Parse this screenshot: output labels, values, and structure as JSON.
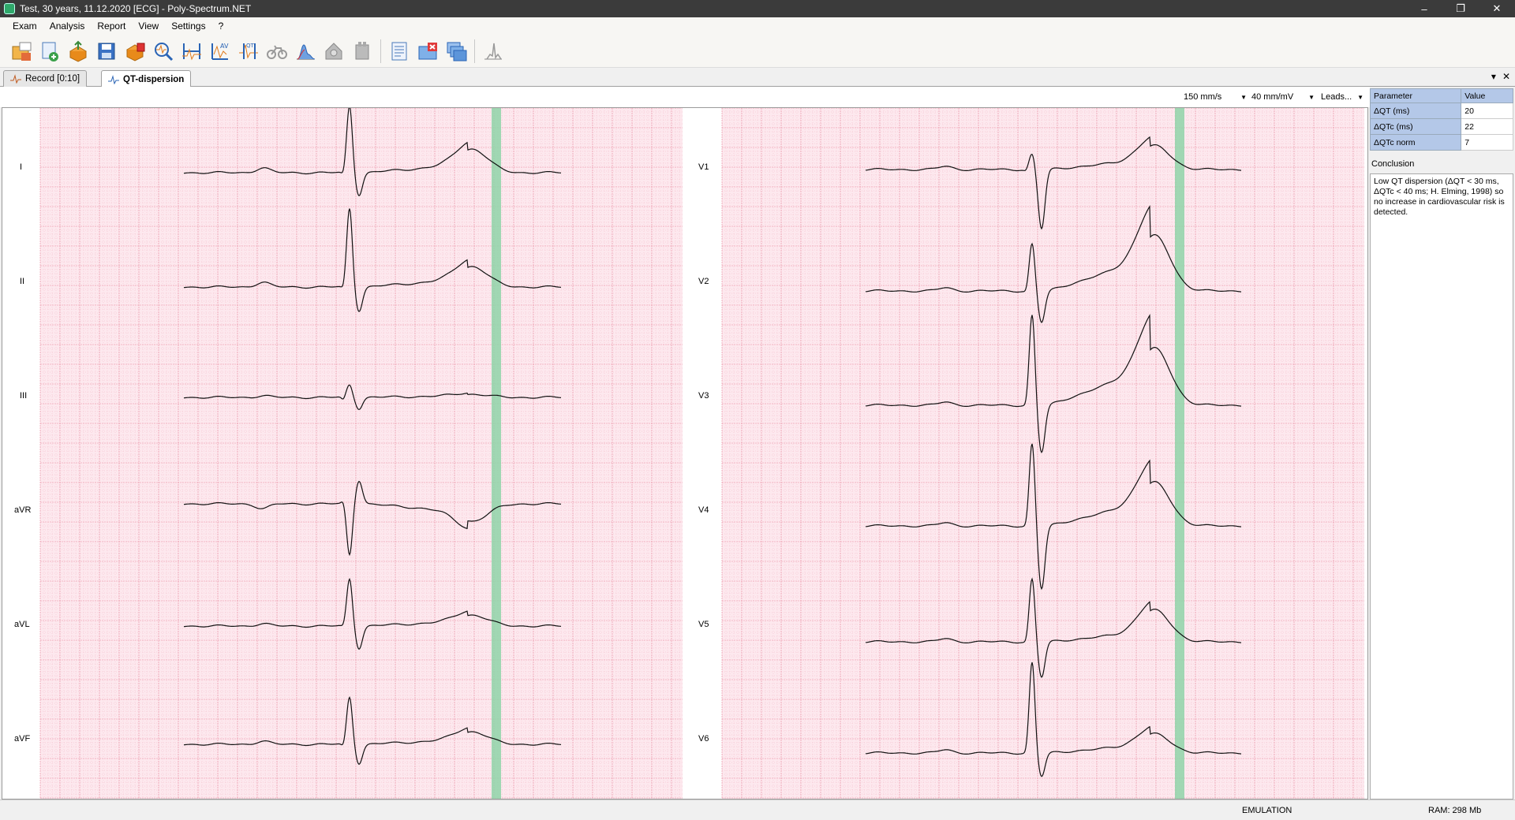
{
  "window": {
    "title": "Test, 30 years, 11.12.2020 [ECG] - Poly-Spectrum.NET",
    "minimize": "–",
    "restore": "❐",
    "close": "✕"
  },
  "menu": [
    "Exam",
    "Analysis",
    "Report",
    "View",
    "Settings",
    "?"
  ],
  "toolbar": {
    "icons": [
      "open-exam-icon",
      "import-icon",
      "export-icon",
      "save-icon",
      "print-icon",
      "ecg-zoom-icon",
      "interval-measure-icon",
      "amplitude-measure-icon",
      "qt-measure-icon",
      "bicycle-test-icon",
      "spectrum-icon",
      "home-icon",
      "device-icon",
      "report-icon",
      "close-window-icon",
      "windows-icon",
      "signal-icon"
    ],
    "separator_after": [
      12,
      15
    ]
  },
  "tabs": [
    {
      "label": "Record [0:10]",
      "active": false
    },
    {
      "label": "QT-dispersion",
      "active": true
    }
  ],
  "tab_controls": {
    "dropdown": "▾",
    "close": "✕"
  },
  "options": {
    "speed": "150 mm/s",
    "gain": "40 mm/mV",
    "leads": "Leads..."
  },
  "leads_left": [
    "I",
    "II",
    "III",
    "aVR",
    "aVL",
    "aVF"
  ],
  "leads_right": [
    "V1",
    "V2",
    "V3",
    "V4",
    "V5",
    "V6"
  ],
  "colors": {
    "grid_minor": "#f3b8c4",
    "grid_major": "#e8879c",
    "paper": "#fde8ee",
    "qt_marker": "#8fd3a8",
    "trace": "#111111"
  },
  "parameters": {
    "header": {
      "name": "Parameter",
      "value": "Value"
    },
    "rows": [
      {
        "name": "ΔQT (ms)",
        "value": "20"
      },
      {
        "name": "ΔQTc (ms)",
        "value": "22"
      },
      {
        "name": "ΔQTc norm",
        "value": "7"
      }
    ]
  },
  "conclusion": {
    "label": "Conclusion",
    "text": "Low QT dispersion (ΔQT < 30 ms, ΔQTc < 40 ms; H. Elming, 1998) so no increase in cardiovascular risk is detected."
  },
  "status": {
    "mode": "EMULATION",
    "ram": "RAM: 298 Mb"
  }
}
